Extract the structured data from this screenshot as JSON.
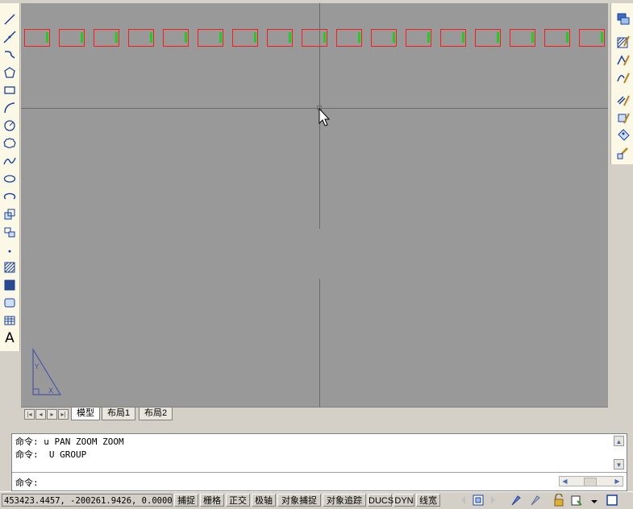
{
  "drawing": {
    "rectangle_count": 17,
    "colors": {
      "background": "#999999",
      "rect_outline": "#ff1a1a",
      "rect_mark": "#22cc22",
      "crosshair": "#6a6a6a"
    }
  },
  "tabs": [
    {
      "label": "模型",
      "active": true
    },
    {
      "label": "布局1",
      "active": false
    },
    {
      "label": "布局2",
      "active": false
    }
  ],
  "command": {
    "history": [
      "命令: u PAN ZOOM ZOOM",
      "命令:  U GROUP"
    ],
    "prompt": "命令:"
  },
  "status": {
    "coordinates": "453423.4457, -200261.9426, 0.0000",
    "toggles": [
      "捕捉",
      "栅格",
      "正交",
      "极轴",
      "对象捕捉",
      "对象追踪",
      "DUCS",
      "DYN",
      "线宽"
    ]
  },
  "toolbars": {
    "draw": [
      "line-icon",
      "construction-line-icon",
      "polyline-icon",
      "polygon-icon",
      "rectangle-icon",
      "arc-icon",
      "circle-icon",
      "revision-cloud-icon",
      "spline-icon",
      "ellipse-icon",
      "ellipse-arc-icon",
      "insert-block-icon",
      "make-block-icon",
      "point-icon",
      "hatch-icon",
      "gradient-icon",
      "region-icon",
      "table-icon",
      "multiline-text-icon"
    ],
    "modify": [
      "draw-order-icon",
      "hatch-edit-icon",
      "polyline-edit-icon",
      "spline-edit-icon",
      "multiline-edit-icon",
      "attribute-edit-icon",
      "block-attribute-icon",
      "sync-attributes-icon"
    ]
  }
}
